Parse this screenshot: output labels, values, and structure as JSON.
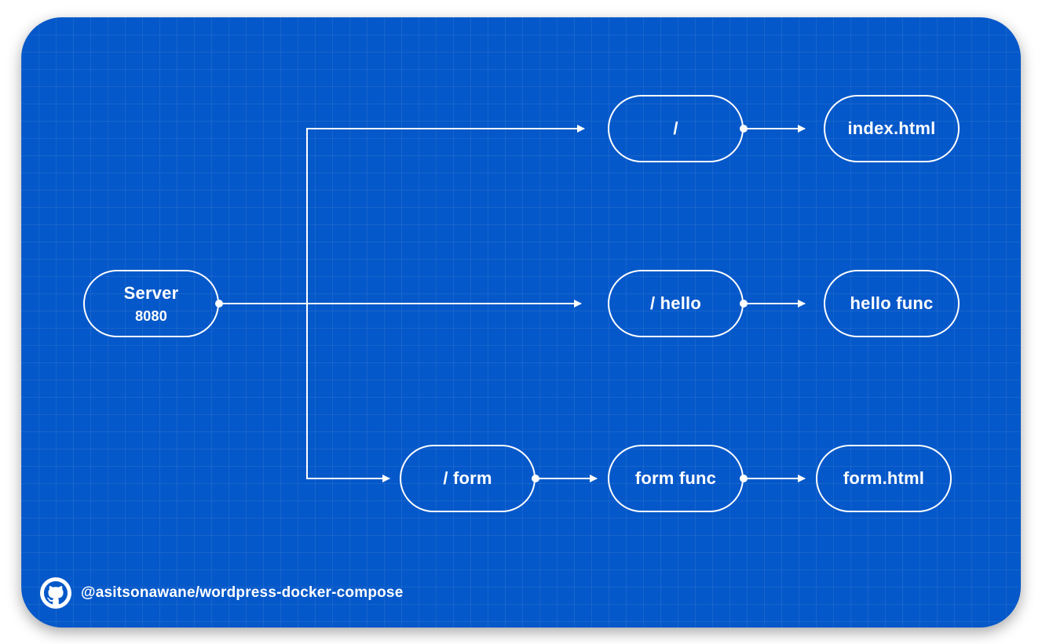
{
  "diagram": {
    "nodes": {
      "server": {
        "label": "Server",
        "sub": "8080"
      },
      "route_root": {
        "label": "/"
      },
      "route_hello": {
        "label": "/ hello"
      },
      "route_form": {
        "label": "/ form"
      },
      "index_html": {
        "label": "index.html"
      },
      "hello_func": {
        "label": "hello func"
      },
      "form_func": {
        "label": "form func"
      },
      "form_html": {
        "label": "form.html"
      }
    },
    "edges": [
      {
        "from": "server",
        "to": "route_root"
      },
      {
        "from": "server",
        "to": "route_hello"
      },
      {
        "from": "server",
        "to": "route_form"
      },
      {
        "from": "route_root",
        "to": "index_html"
      },
      {
        "from": "route_hello",
        "to": "hello_func"
      },
      {
        "from": "route_form",
        "to": "form_func"
      },
      {
        "from": "form_func",
        "to": "form_html"
      }
    ]
  },
  "footer": {
    "icon": "github-icon",
    "handle": "@asitsonawane/wordpress-docker-compose"
  },
  "colors": {
    "background": "#0558c9",
    "stroke": "#ffffff"
  }
}
